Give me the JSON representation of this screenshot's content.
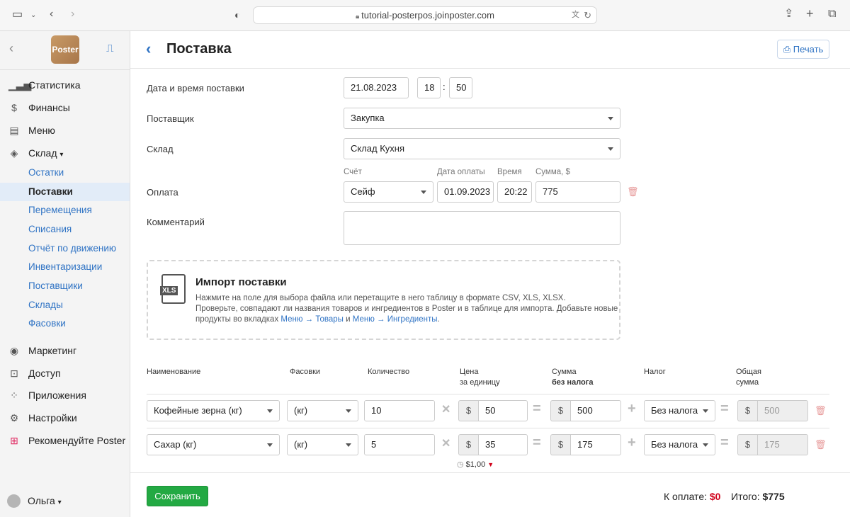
{
  "browser": {
    "url": "tutorial-posterpos.joinposter.com"
  },
  "sidebar": {
    "logo": "Poster",
    "items": [
      {
        "label": "Статистика",
        "icon": "bar-chart-icon"
      },
      {
        "label": "Финансы",
        "icon": "dollar-icon"
      },
      {
        "label": "Меню",
        "icon": "document-icon"
      },
      {
        "label": "Склад",
        "icon": "layers-icon",
        "caret": "▾"
      }
    ],
    "sub": [
      "Остатки",
      "Поставки",
      "Перемещения",
      "Списания",
      "Отчёт по движению",
      "Инвентаризации",
      "Поставщики",
      "Склады",
      "Фасовки"
    ],
    "items2": [
      {
        "label": "Маркетинг",
        "icon": "target-icon"
      },
      {
        "label": "Доступ",
        "icon": "lock-icon"
      },
      {
        "label": "Приложения",
        "icon": "grid-icon"
      },
      {
        "label": "Настройки",
        "icon": "gear-icon"
      },
      {
        "label": "Рекомендуйте Poster",
        "icon": "gift-icon"
      }
    ],
    "user": "Ольга",
    "user_caret": "▾"
  },
  "page": {
    "title": "Поставка",
    "print": "Печать"
  },
  "form": {
    "date_label": "Дата и время поставки",
    "date": "21.08.2023",
    "hour": "18",
    "minute": "50",
    "time_sep": ":",
    "supplier_label": "Поставщик",
    "supplier": "Закупка",
    "warehouse_label": "Склад",
    "warehouse": "Склад Кухня",
    "payment_label": "Оплата",
    "account_h": "Счёт",
    "paydate_h": "Дата оплаты",
    "time_h": "Время",
    "sum_h": "Сумма, $",
    "account": "Сейф",
    "paydate": "01.09.2023",
    "paytime": "20:22",
    "sum": "775",
    "comment_label": "Комментарий"
  },
  "import": {
    "title": "Импорт поставки",
    "icon_text": "XLS",
    "line1": "Нажмите на поле для выбора файла или перетащите в него таблицу в формате CSV, XLS, XLSX.",
    "line2": "Проверьте, совпадают ли названия товаров и ингредиентов в Poster и в таблице для импорта. Добавьте новые",
    "line3a": "продукты во вкладках ",
    "link1": "Меню → Товары",
    "line3b": " и ",
    "link2": "Меню → Ингредиенты",
    "line3c": "."
  },
  "table": {
    "headers": {
      "name": "Наименование",
      "pack": "Фасовки",
      "qty": "Количество",
      "price1": "Цена",
      "price2": "за единицу",
      "sum1": "Сумма",
      "sum2": "без налога",
      "tax": "Налог",
      "total1": "Общая",
      "total2": "сумма"
    },
    "currency": "$",
    "ops": {
      "times": "✕",
      "eq": "=",
      "plus": "+"
    },
    "rows": [
      {
        "name": "Кофейные зерна (кг)",
        "pack": "(кг)",
        "qty": "10",
        "price": "50",
        "sum": "500",
        "tax": "Без налога",
        "total": "500"
      },
      {
        "name": "Сахар (кг)",
        "pack": "(кг)",
        "qty": "5",
        "price": "35",
        "sum": "175",
        "tax": "Без налога",
        "total": "175"
      }
    ],
    "price_hint": "$1,00"
  },
  "footer": {
    "save": "Сохранить",
    "topay_label": "К оплате:",
    "topay": "$0",
    "total_label": "Итого:",
    "total": "$775"
  }
}
